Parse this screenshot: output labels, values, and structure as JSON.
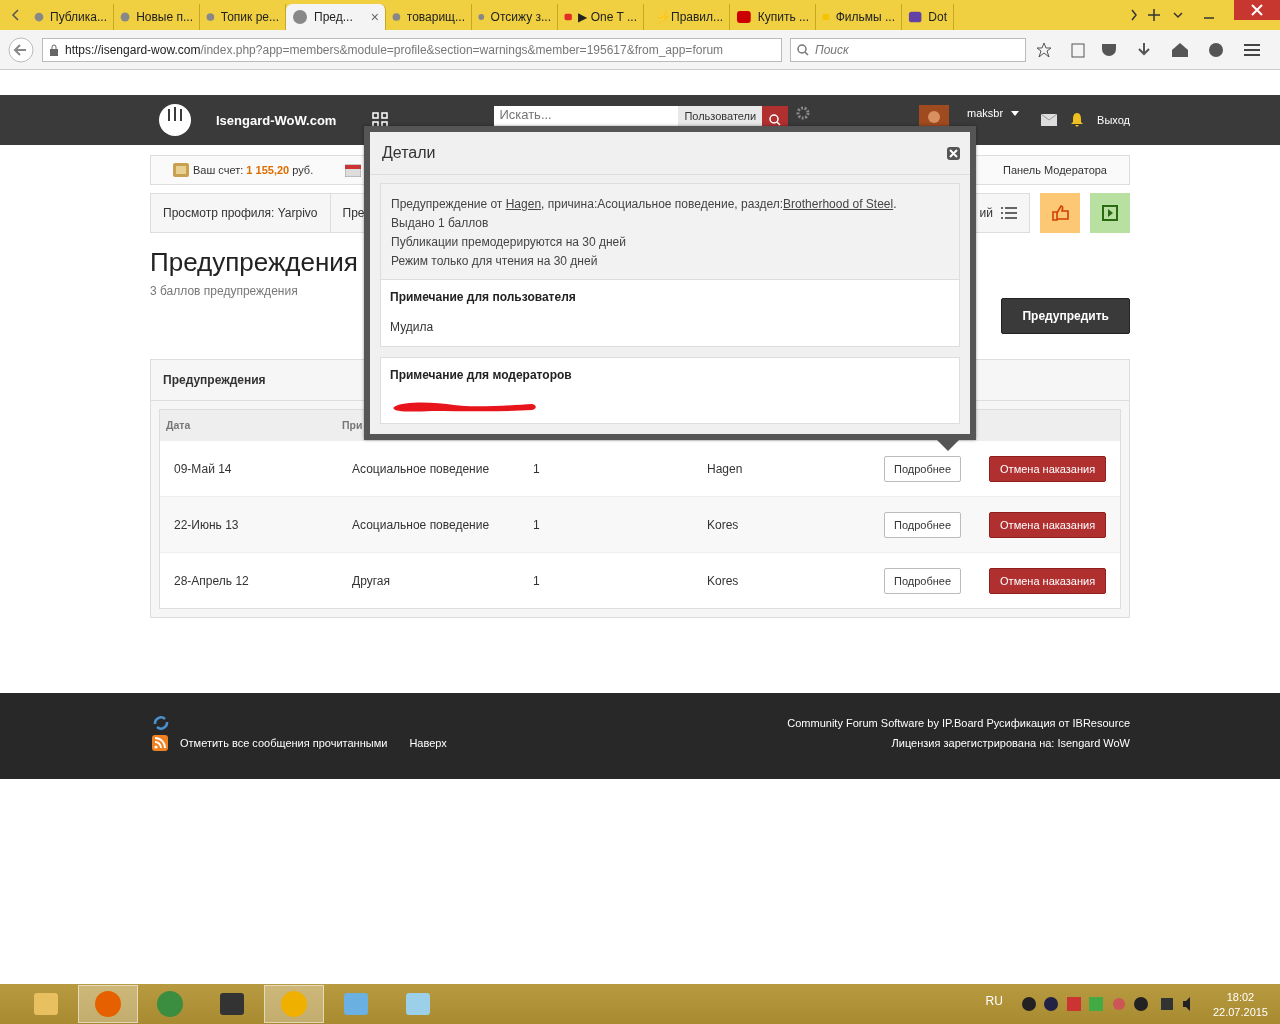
{
  "browser": {
    "tabs": [
      {
        "label": "Публика...",
        "kind": "forum",
        "selected": false
      },
      {
        "label": "Новые п...",
        "kind": "forum",
        "selected": false
      },
      {
        "label": "Топик ре...",
        "kind": "forum",
        "selected": false
      },
      {
        "label": "Пред...",
        "kind": "forum",
        "selected": true,
        "close": "×"
      },
      {
        "label": "товарищ...",
        "kind": "forum",
        "selected": false
      },
      {
        "label": "Отсижу з...",
        "kind": "forum",
        "selected": false
      },
      {
        "label": "▶ One T ...",
        "kind": "video",
        "selected": false
      },
      {
        "label": "⚡Правил...",
        "kind": "puzzle",
        "selected": false
      },
      {
        "label": "Купить ...",
        "kind": "car",
        "selected": false
      },
      {
        "label": "Фильмы ...",
        "kind": "star",
        "selected": false
      },
      {
        "label": "Dot",
        "kind": "stream",
        "selected": false
      }
    ],
    "url_host": "https://isengard-wow.com",
    "url_path": "/index.php?app=members&module=profile&section=warnings&member=195617&from_app=forum",
    "search": {
      "placeholder": "Поиск"
    }
  },
  "site": {
    "name": "Isengard-WoW.com",
    "search": {
      "placeholder": "Искать...",
      "scope": "Пользователи"
    },
    "user": "maksbr",
    "logout": "Выход",
    "account": {
      "label": "Ваш счет:",
      "amount": "1 155,20",
      "currency": "руб."
    },
    "mod_panel": "Панель Модератора",
    "breadcrumbs": [
      "Просмотр профиля: Yarpivo",
      "Пре"
    ],
    "breadcrumb_tail": "ий",
    "title": "Предупреждения",
    "subtitle": "3 баллов предупреждения",
    "warn_button": "Предупредить",
    "panel_title": "Предупреждения",
    "columns": [
      "Дата",
      "При"
    ],
    "rows": [
      {
        "date": "09-Май 14",
        "reason": "Асоциальное поведение",
        "points": "1",
        "moderator": "Hagen",
        "details": "Подробнее",
        "revoke": "Отмена наказания"
      },
      {
        "date": "22-Июнь 13",
        "reason": "Асоциальное поведение",
        "points": "1",
        "moderator": "Kores",
        "details": "Подробнее",
        "revoke": "Отмена наказания"
      },
      {
        "date": "28-Апрель 12",
        "reason": "Другая",
        "points": "1",
        "moderator": "Kores",
        "details": "Подробнее",
        "revoke": "Отмена наказания"
      }
    ],
    "footer": {
      "mark_read": "Отметить все сообщения прочитанными",
      "top": "Наверх",
      "credit": "Community Forum Software by IP.Board Русификация от IBResource",
      "license": "Лицензия зарегистрирована на: Isengard WoW"
    }
  },
  "modal": {
    "title": "Детали",
    "summary": [
      {
        "before": "Предупреждение от ",
        "link1": "Hagen",
        "middle": ", причина:Асоциальное поведение, раздел:",
        "link2": "Brotherhood of Steel",
        "after": "."
      }
    ],
    "lines": [
      "Выдано 1 баллов",
      "Публикации премодерируются на 30 дней",
      "Режим только для чтения на 30 дней"
    ],
    "user_note_title": "Примечание для пользователя",
    "user_note": "Мудила",
    "mod_note_title": "Примечание для модераторов"
  },
  "taskbar": {
    "apps": [
      {
        "kind": "folder",
        "selected": false
      },
      {
        "kind": "firefox",
        "selected": true
      },
      {
        "kind": "chrome",
        "selected": false
      },
      {
        "kind": "media",
        "selected": false
      },
      {
        "kind": "aimp",
        "selected": true
      },
      {
        "kind": "paint",
        "selected": false
      },
      {
        "kind": "notepad",
        "selected": false
      }
    ],
    "language": "RU",
    "time": "18:02",
    "date": "22.07.2015"
  }
}
